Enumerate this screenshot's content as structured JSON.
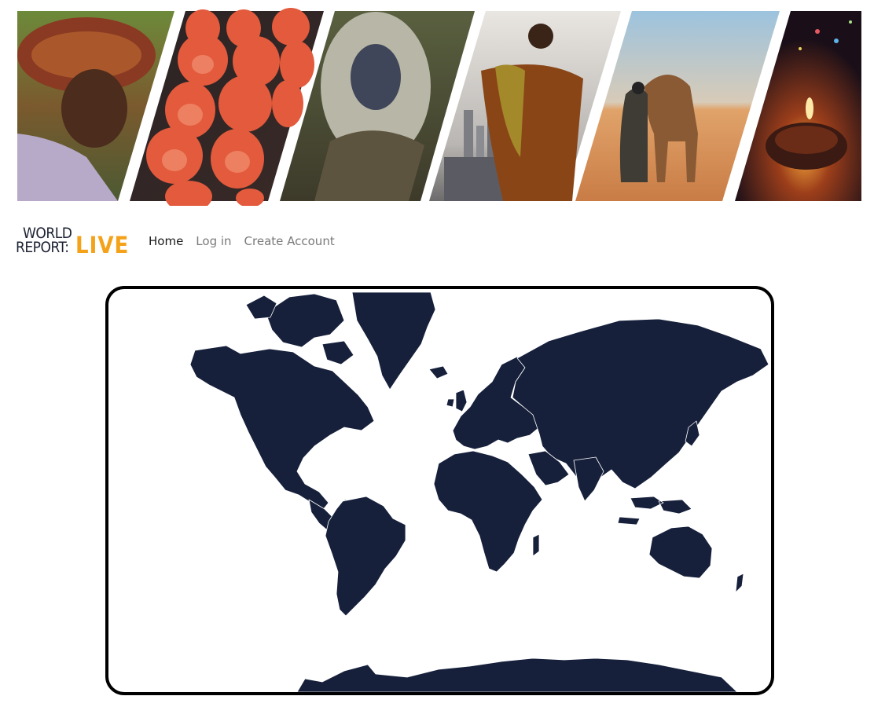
{
  "banner": {
    "photos": [
      {
        "name": "woman-headscarf-photo"
      },
      {
        "name": "painted-masks-photo"
      },
      {
        "name": "costumed-figure-photo"
      },
      {
        "name": "monk-city-photo"
      },
      {
        "name": "camel-desert-photo"
      },
      {
        "name": "candle-hands-photo"
      }
    ]
  },
  "logo": {
    "line1": "WORLD",
    "line2": "REPORT:",
    "line3": "LIVE"
  },
  "nav": {
    "home": "Home",
    "login": "Log in",
    "create_account": "Create Account"
  },
  "colors": {
    "land": "#16203b",
    "accent": "#f5a21b",
    "border": "#000000"
  },
  "map": {
    "type": "world-map",
    "projection": "mercator"
  }
}
